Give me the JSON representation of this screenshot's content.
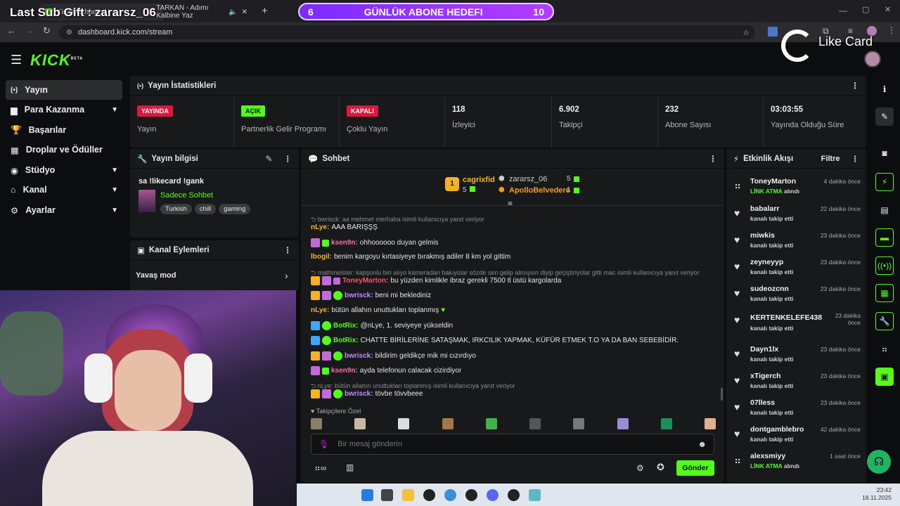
{
  "overlay": {
    "last_sub": "Last Sub Gift : zararsz_06",
    "goal_current": "6",
    "goal_title": "GÜNLÜK ABONE HEDEFI",
    "goal_target": "10",
    "sponsor": "Like Card"
  },
  "browser": {
    "tab1": "Kick Dashboard",
    "tab2": "TARKAN - Adımı Kalbine Yaz",
    "url": "dashboard.kick.com/stream"
  },
  "app": {
    "logo": "KICK",
    "logo_badge": "BETA"
  },
  "sidebar": {
    "items": [
      {
        "label": "Yayın"
      },
      {
        "label": "Para Kazanma"
      },
      {
        "label": "Başarılar"
      },
      {
        "label": "Droplar ve Ödüller"
      },
      {
        "label": "Stüdyo"
      },
      {
        "label": "Kanal"
      },
      {
        "label": "Ayarlar"
      }
    ]
  },
  "stats": {
    "title": "Yayın İstatistikleri",
    "items": [
      {
        "value": "YAYINDA",
        "label": "Yayın"
      },
      {
        "value": "AÇIK",
        "label": "Partnerlik Gelir Programı"
      },
      {
        "value": "KAPALI",
        "label": "Çoklu Yayın"
      },
      {
        "value": "118",
        "label": "İzleyici"
      },
      {
        "value": "6.902",
        "label": "Takipçi"
      },
      {
        "value": "232",
        "label": "Abone Sayısı"
      },
      {
        "value": "03:03:55",
        "label": "Yayında Olduğu Süre"
      }
    ]
  },
  "stream_info": {
    "title": "Yayın bilgisi",
    "stream_title": "sa !likecard !gank",
    "category": "Sadece Sohbet",
    "tags": [
      "Turkish",
      "chill",
      "gaming"
    ]
  },
  "channel_actions": {
    "title": "Kanal Eylemleri",
    "slow_mode": "Yavaş mod"
  },
  "chat": {
    "title": "Sohbet",
    "top": [
      {
        "rank": "1",
        "name": "cagrixfid",
        "count": "5"
      },
      {
        "name": "zararsz_06",
        "count": "5"
      },
      {
        "name": "ApolloBelvedere",
        "count": "1"
      }
    ],
    "lines": [
      {
        "reply": "bwrisck: aa mehmet merhaba isimli kullanıcıya yanıt veriyor"
      },
      {
        "user": "nLye:",
        "text": "AAA BARIŞŞŞ"
      },
      {
        "user": "ksen9n:",
        "text": "ohhoooooo duyan gelmis"
      },
      {
        "user": "lbogil:",
        "text": "benim kargoyu kırtasiyeye bırakmış adiler 8 km yol gittim"
      },
      {
        "reply": "mathmeister: kapşonlu biri alıyo kameradan bakıyolar sözde sen gelip almışsın diyip geçiştiriyolar gitti mac isimli kullanıcıya yanıt veriyor"
      },
      {
        "user": "ToneyMarton:",
        "text": "bu yüzden kimlikle ibraz gerekli 7500 tl üstü kargolarda"
      },
      {
        "user": "bwrisck:",
        "text": "beni mi beklediniz"
      },
      {
        "user": "nLye:",
        "text": "bütün allahın unuttukları toplanmış"
      },
      {
        "user": "BotRix:",
        "text": "@nLye, 1. seviyeye yükseldin"
      },
      {
        "user": "BotRix:",
        "text": "CHATTE BİRİLERİNE SATAŞMAK, IRKCILIK YAPMAK, KÜFÜR ETMEK T.O YA DA BAN SEBEBİDİR."
      },
      {
        "user": "bwrisck:",
        "text": "bildirim geldikçe mik mi cızırdıyo"
      },
      {
        "user": "ksen9n:",
        "text": "ayda telefonun calacak cizirdiyor"
      },
      {
        "reply": "nLye: bütün allahın unuttukları toplanmış isimli kullanıcıya yanıt veriyor"
      },
      {
        "user": "bwrisck:",
        "text": "tövbe tövvbeee"
      }
    ],
    "followers_only": "Takipçilere Özel",
    "input_placeholder": "Bir mesaj gönderin",
    "send": "Gönder"
  },
  "events": {
    "title": "Etkinlik Akışı",
    "filter": "Filtre",
    "items": [
      {
        "name": "ToneyMarton",
        "desc_hl": "LİNK ATMA",
        "desc": " alındı",
        "time": "4 dakika önce"
      },
      {
        "name": "babalarr",
        "desc": "kanalı takip etti",
        "time": "22 dakika önce"
      },
      {
        "name": "miwkis",
        "desc": "kanalı takip etti",
        "time": "23 dakika önce"
      },
      {
        "name": "zeyneyyp",
        "desc": "kanalı takip etti",
        "time": "23 dakika önce"
      },
      {
        "name": "sudeozcnn",
        "desc": "kanalı takip etti",
        "time": "23 dakika önce"
      },
      {
        "name": "KERTENKELEFE438",
        "desc": "kanalı takip etti",
        "time": "23 dakika önce"
      },
      {
        "name": "Dayn1lx",
        "desc": "kanalı takip etti",
        "time": "23 dakika önce"
      },
      {
        "name": "xTigerch",
        "desc": "kanalı takip etti",
        "time": "23 dakika önce"
      },
      {
        "name": "07lless",
        "desc": "kanalı takip etti",
        "time": "23 dakika önce"
      },
      {
        "name": "dontgamblebro",
        "desc": "kanalı takip etti",
        "time": "42 dakika önce"
      },
      {
        "name": "alexsmiyy",
        "desc_hl": "LİNK ATMA",
        "desc": " alındı",
        "time": "1 saat önce"
      }
    ]
  },
  "taskbar": {
    "time": "23:42",
    "date": "18.11.2025"
  },
  "colors": {
    "kick_green": "#53fc18",
    "live_red": "#e0173d",
    "panel": "#18191b"
  }
}
